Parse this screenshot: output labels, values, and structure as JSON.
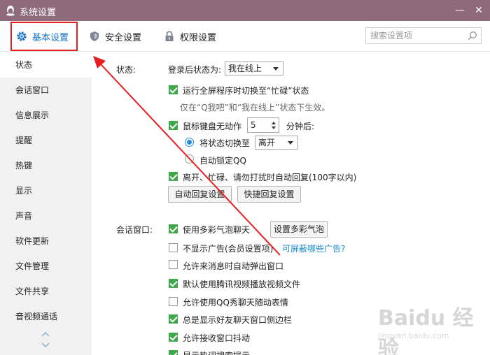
{
  "window": {
    "title": "系统设置",
    "minimize": "—",
    "close": "✕"
  },
  "toolbar": {
    "tabs": [
      {
        "label": "基本设置",
        "icon": "gear-icon",
        "active": true
      },
      {
        "label": "安全设置",
        "icon": "shield-icon"
      },
      {
        "label": "权限设置",
        "icon": "lock-icon"
      }
    ],
    "search_placeholder": "搜索设置项"
  },
  "sidebar": {
    "items": [
      {
        "label": "状态",
        "active": true
      },
      {
        "label": "会话窗口"
      },
      {
        "label": "信息展示"
      },
      {
        "label": "提醒"
      },
      {
        "label": "热键"
      },
      {
        "label": "显示"
      },
      {
        "label": "声音"
      },
      {
        "label": "软件更新"
      },
      {
        "label": "文件管理"
      },
      {
        "label": "文件共享"
      },
      {
        "label": "音视频通话"
      }
    ]
  },
  "status": {
    "section_label": "状态:",
    "login_status_label": "登录后状态为:",
    "login_status_value": "我在线上",
    "fullscreen_busy": {
      "label": "运行全屏程序时切换至“忙碌”状态",
      "checked": true
    },
    "fullscreen_note": "仅在“Q我吧”和“我在线上”状态下生效。",
    "idle": {
      "label": "鼠标键盘无动作",
      "checked": true,
      "minutes": "5",
      "minutes_suffix": "分钟后:"
    },
    "switch_status": {
      "label": "将状态切换至",
      "checked": true,
      "value": "离开"
    },
    "auto_lock": {
      "label": "自动锁定QQ",
      "checked": false
    },
    "auto_reply": {
      "label": "离开、忙碌、请勿打扰时自动回复(100字以内)",
      "checked": true
    },
    "auto_reply_settings_btn": "自动回复设置",
    "quick_reply_settings_btn": "快捷回复设置"
  },
  "session": {
    "section_label": "会话窗口:",
    "bubble_btn": "设置多彩气泡",
    "ads_link": "可屏蔽哪些广告?",
    "options": [
      {
        "label": "使用多彩气泡聊天",
        "checked": true
      },
      {
        "label": "不显示广告(会员设置项)",
        "checked": false
      },
      {
        "label": "允许来消息时自动弹出窗口",
        "checked": false
      },
      {
        "label": "默认使用腾讯视频播放视频文件",
        "checked": true
      },
      {
        "label": "允许使用QQ秀聊天随动表情",
        "checked": false
      },
      {
        "label": "总是显示好友聊天窗口侧边栏",
        "checked": true
      },
      {
        "label": "允许接收窗口抖动",
        "checked": true
      },
      {
        "label": "显示热词搜索提示",
        "checked": true
      }
    ]
  },
  "watermark": {
    "main": "Baidu 经验",
    "sub": "jingyan.baidu.com"
  },
  "colors": {
    "titlebar": "#8e6a7b",
    "accent": "#1a73c8",
    "check": "#3fa84a",
    "annotation": "#e62020"
  }
}
